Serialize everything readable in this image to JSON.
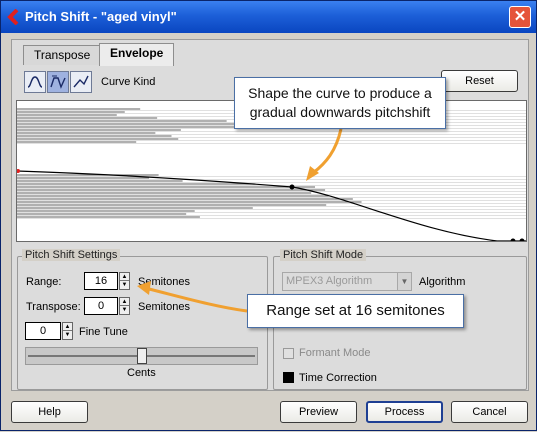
{
  "window": {
    "title": "Pitch Shift - \"aged vinyl\"",
    "close_glyph": "✕"
  },
  "tabs": [
    {
      "label": "Transpose",
      "active": false
    },
    {
      "label": "Envelope",
      "active": true
    }
  ],
  "curve_kind": {
    "label": "Curve Kind",
    "buttons": [
      "curve-spline-icon",
      "curve-damped-icon",
      "curve-linear-icon"
    ],
    "selected_index": 1
  },
  "reset_label": "Reset",
  "callouts": {
    "envelope_note": "Shape the curve to produce a gradual downwards pitchshift",
    "range_note": "Range set at 16 semitones"
  },
  "pitch_shift_settings": {
    "group_label": "Pitch Shift Settings",
    "range_label": "Range:",
    "range_value": "16",
    "range_unit": "Semitones",
    "transpose_label": "Transpose:",
    "transpose_value": "0",
    "transpose_unit": "Semitones",
    "fine_tune_value": "0",
    "fine_tune_label": "Fine Tune",
    "cents_label": "Cents",
    "fine_tune_slider_fraction": 0.5
  },
  "pitch_shift_mode": {
    "group_label": "Pitch Shift Mode",
    "algorithm_value": "MPEX3 Algorithm",
    "algorithm_label": "Algorithm",
    "formant_mode_label": "Formant Mode",
    "formant_mode_checked": false,
    "time_correction_label": "Time Correction",
    "time_correction_checked": true
  },
  "footer": {
    "help": "Help",
    "preview": "Preview",
    "process": "Process",
    "cancel": "Cancel"
  },
  "colors": {
    "titlebar": "#1c5fd8",
    "callout_arrow": "#f0a030",
    "waveform": "#808080"
  }
}
